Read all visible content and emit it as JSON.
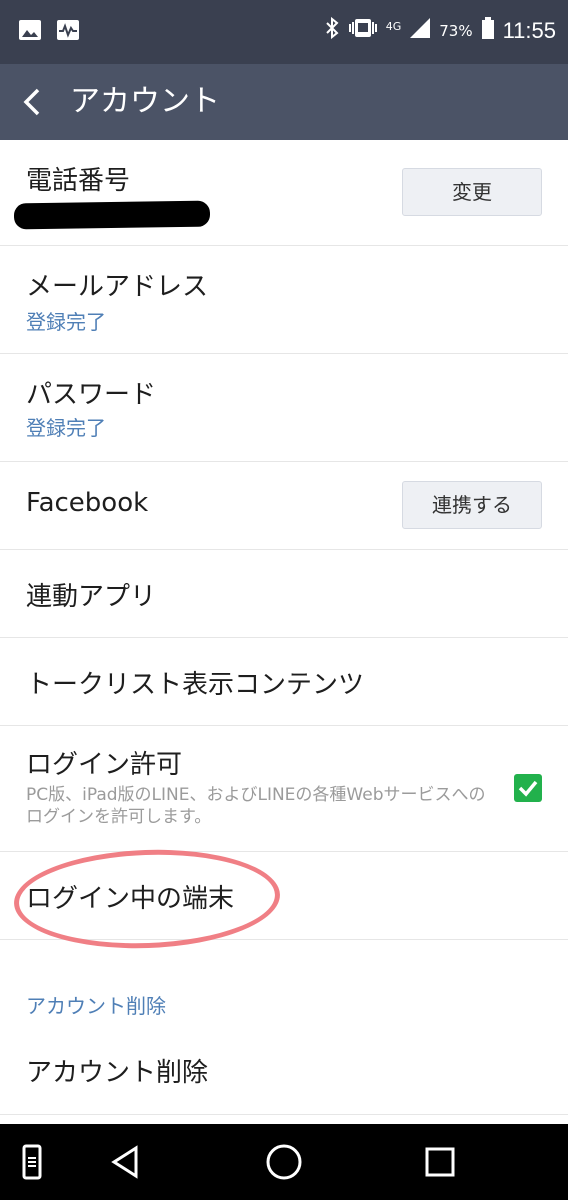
{
  "status_bar": {
    "network": "4G",
    "battery_percent": "73%",
    "time": "11:55"
  },
  "app_bar": {
    "title": "アカウント"
  },
  "rows": {
    "phone": {
      "label": "電話番号",
      "button": "変更"
    },
    "email": {
      "label": "メールアドレス",
      "status": "登録完了"
    },
    "password": {
      "label": "パスワード",
      "status": "登録完了"
    },
    "facebook": {
      "label": "Facebook",
      "button": "連携する"
    },
    "linked_apps": {
      "label": "連動アプリ"
    },
    "talk_list": {
      "label": "トークリスト表示コンテンツ"
    },
    "login_permission": {
      "label": "ログイン許可",
      "description": "PC版、iPad版のLINE、およびLINEの各種Webサービスへのログインを許可します。",
      "checked": true
    },
    "logged_in_devices": {
      "label": "ログイン中の端末"
    }
  },
  "delete_section": {
    "header": "アカウント削除",
    "item": "アカウント削除"
  },
  "colors": {
    "status_bar": "#3a4050",
    "app_bar": "#4b5366",
    "link_blue": "#4f7fb6",
    "check_green": "#22b14c",
    "annotation": "#f07f85"
  }
}
